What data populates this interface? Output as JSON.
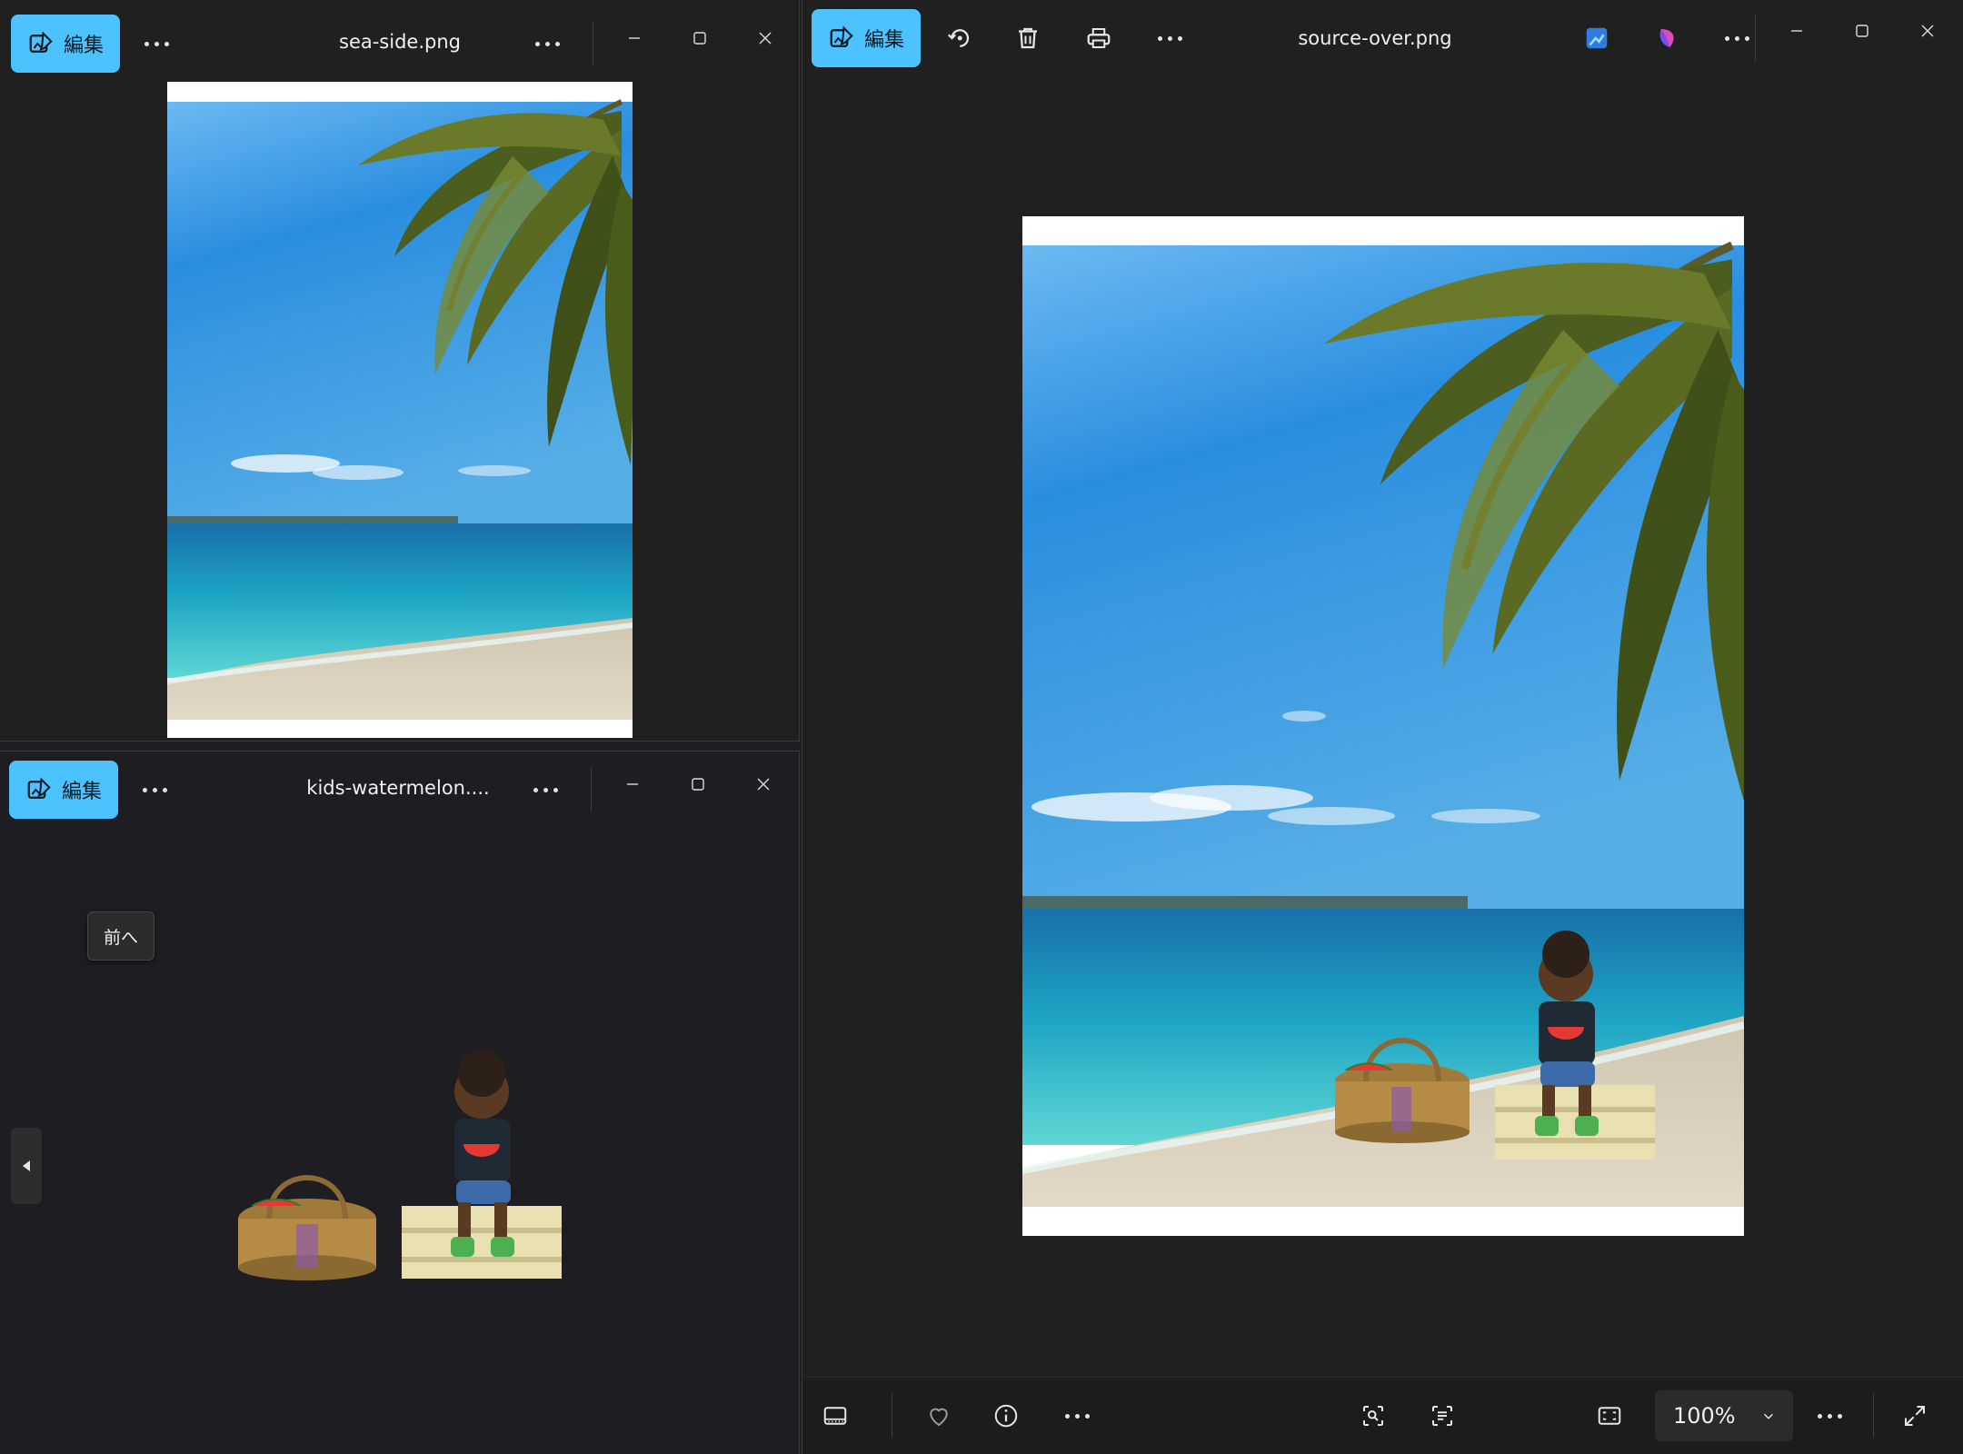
{
  "windows": {
    "seaside": {
      "edit_label": "編集",
      "title": "sea-side.png"
    },
    "kids": {
      "edit_label": "編集",
      "title": "kids-watermelon....",
      "tooltip": "前へ"
    },
    "main": {
      "edit_label": "編集",
      "title": "source-over.png",
      "zoom_value": "100%"
    }
  },
  "colors": {
    "accent": "#4cc2ff",
    "background": "#202020",
    "bottombar": "#1c1c1c"
  },
  "icons": {
    "edit": "edit-image-icon",
    "more": "more-dots-icon",
    "minimize": "minimize-icon",
    "maximize": "maximize-icon",
    "close": "close-icon",
    "rotate": "rotate-icon",
    "delete": "trash-icon",
    "print": "printer-icon",
    "designer": "designer-app-icon",
    "clipchamp": "clipchamp-icon",
    "filmstrip": "filmstrip-icon",
    "favorite": "heart-icon",
    "info": "info-icon",
    "visual-search": "visual-search-icon",
    "text-recognition": "text-scan-icon",
    "fit": "fit-to-window-icon",
    "chevron": "chevron-down-icon",
    "fullscreen": "fullscreen-icon",
    "previous": "previous-arrow-icon"
  }
}
